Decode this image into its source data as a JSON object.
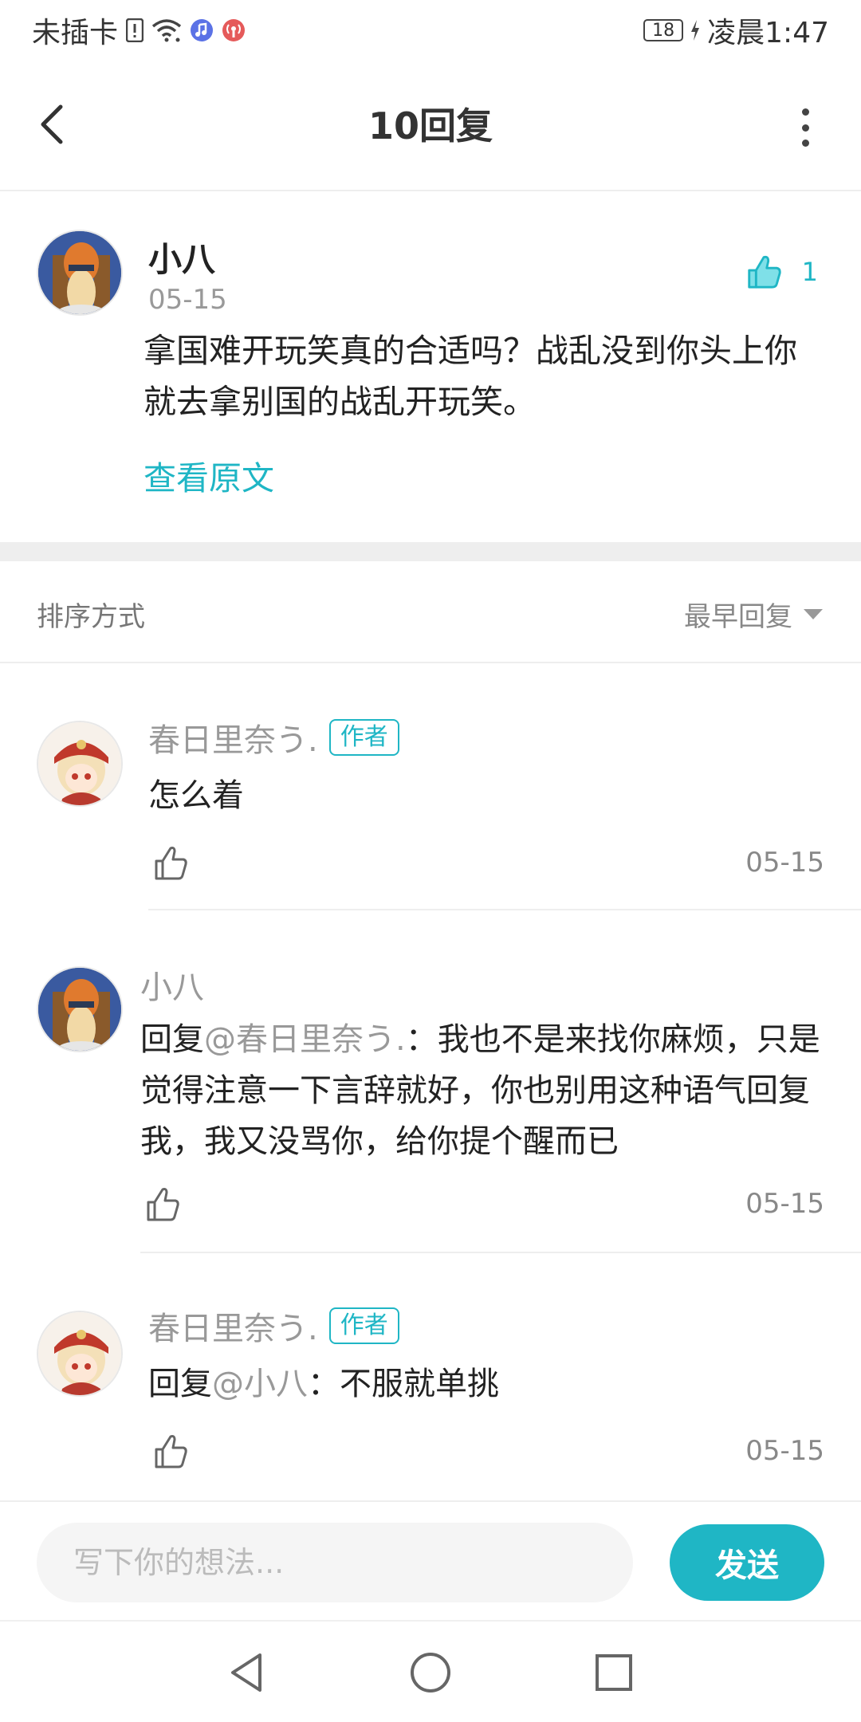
{
  "status_bar": {
    "carrier": "未插卡",
    "battery_level": "18",
    "time": "凌晨1:47",
    "icons": [
      "sim-alert-icon",
      "wifi-icon",
      "music-icon",
      "podcast-icon",
      "battery-icon",
      "charging-icon"
    ]
  },
  "header": {
    "title": "10回复",
    "back_icon": "chevron-left-icon",
    "more_icon": "more-vertical-icon"
  },
  "original_post": {
    "author": "小八",
    "date": "05-15",
    "like_count": "1",
    "text": "拿国难开玩笑真的合适吗？战乱没到你头上你就去拿别国的战乱开玩笑。",
    "view_original_label": "查看原文"
  },
  "sort": {
    "label": "排序方式",
    "value": "最早回复"
  },
  "replies": [
    {
      "author": "春日里奈う.",
      "badge": "作者",
      "reply_prefix": "",
      "mention": "",
      "text": "怎么着",
      "date": "05-15"
    },
    {
      "author": "小八",
      "badge": "",
      "reply_prefix": "回复",
      "mention": "@春日里奈う.",
      "text": "：我也不是来找你麻烦，只是觉得注意一下言辞就好，你也别用这种语气回复我，我又没骂你，给你提个醒而已",
      "date": "05-15"
    },
    {
      "author": "春日里奈う.",
      "badge": "作者",
      "reply_prefix": "回复",
      "mention": "@小八",
      "text": "：不服就单挑",
      "date": "05-15"
    }
  ],
  "comment_box": {
    "placeholder": "写下你的想法...",
    "send_label": "发送"
  },
  "colors": {
    "accent": "#1fb6c5",
    "text_primary": "#222222",
    "text_secondary": "#999999",
    "divider": "#eeeeee"
  }
}
